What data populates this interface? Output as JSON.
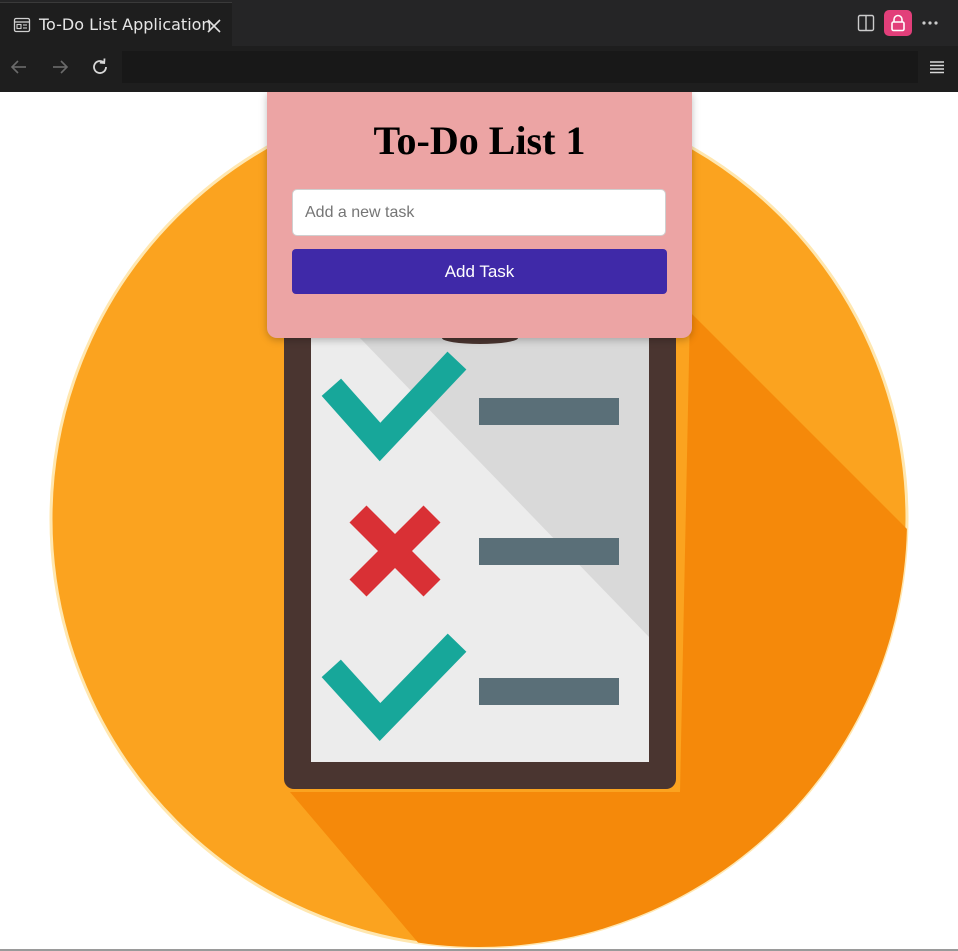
{
  "window": {
    "tab_title": "To-Do List Application",
    "address": ""
  },
  "icons": {
    "tab": "page-icon",
    "close": "close-icon",
    "split": "split-editor-icon",
    "lock": "lock-icon",
    "more": "more-icon",
    "back": "arrow-left-icon",
    "forward": "arrow-right-icon",
    "reload": "reload-icon",
    "menu": "menu-icon"
  },
  "app": {
    "title": "To-Do List 1",
    "task_input": {
      "value": "",
      "placeholder": "Add a new task"
    },
    "add_button_label": "Add Task"
  },
  "colors": {
    "card_background": "#eca4a4",
    "button_background": "#3f29a8",
    "lock_accent": "#e23f7a",
    "circle_orange": "#fba31f",
    "shadow_orange": "#f5890a",
    "check_teal": "#17a79a",
    "cross_red": "#d93035",
    "line_slate": "#5a6f78"
  },
  "background_image": {
    "content": "clipboard checklist icon on orange circle"
  }
}
